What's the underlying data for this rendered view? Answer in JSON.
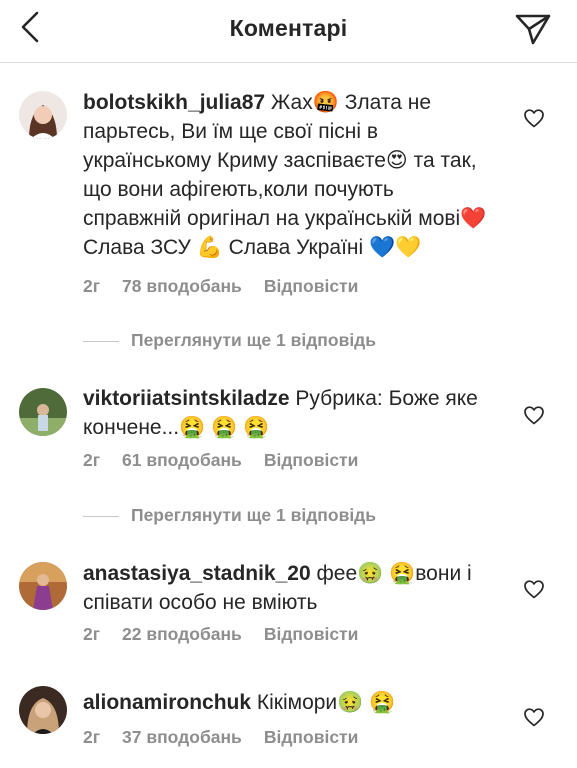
{
  "header": {
    "title": "Коментарі",
    "back_icon": "chevron-left-icon",
    "send_icon": "paper-plane-icon"
  },
  "comments": [
    {
      "username": "bolotskikh_julia87",
      "text": "Жах🤬 Злата не парьтесь, Ви їм ще свої пісні в українському Криму заспіваєте😍 та так, що вони афігеють,коли почують справжній оригінал на українській мові❤️ Слава ЗСУ 💪 Слава Україні 💙💛",
      "time": "2г",
      "likes": "78 вподобань",
      "reply": "Відповісти",
      "more_replies": "Переглянути ще 1 відповідь"
    },
    {
      "username": "viktoriiatsintskiladze",
      "text": "Рубрика:  Боже яке кончене...🤮 🤮 🤮",
      "time": "2г",
      "likes": "61 вподобань",
      "reply": "Відповісти",
      "more_replies": "Переглянути ще 1 відповідь"
    },
    {
      "username": "anastasiya_stadnik_20",
      "text": "фее🤢 🤮вони і співати особо не вміють",
      "time": "2г",
      "likes": "22 вподобань",
      "reply": "Відповісти"
    },
    {
      "username": "alionamironchuk",
      "text": "Кікімори🤢 🤮",
      "time": "2г",
      "likes": "37 вподобань",
      "reply": "Відповісти"
    }
  ],
  "colors": {
    "text": "#262626",
    "secondary": "#8e8e8e",
    "divider": "#dbdbdb"
  }
}
